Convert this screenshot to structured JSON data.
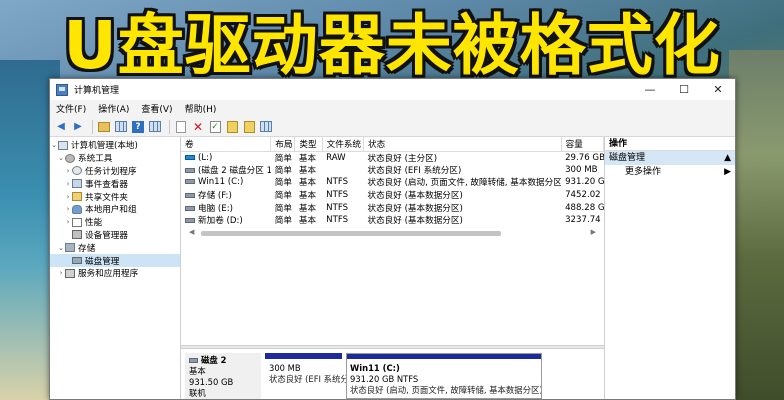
{
  "banner": {
    "text": "U盘驱动器未被格式化"
  },
  "window": {
    "title": "计算机管理",
    "controls": {
      "minimize": "—",
      "maximize": "☐",
      "close": "✕"
    }
  },
  "menu": [
    "文件(F)",
    "操作(A)",
    "查看(V)",
    "帮助(H)"
  ],
  "tree": {
    "root": "计算机管理(本地)",
    "system_tools": "系统工具",
    "task_scheduler": "任务计划程序",
    "event_viewer": "事件查看器",
    "shared_folders": "共享文件夹",
    "local_users": "本地用户和组",
    "performance": "性能",
    "device_manager": "设备管理器",
    "storage": "存储",
    "disk_management": "磁盘管理",
    "services_apps": "服务和应用程序"
  },
  "table": {
    "headers": [
      "卷",
      "布局",
      "类型",
      "文件系统",
      "状态",
      "容量"
    ],
    "rows": [
      [
        "(L:)",
        "简单",
        "基本",
        "RAW",
        "状态良好 (主分区)",
        "29.76 GB"
      ],
      [
        "(磁盘 2 磁盘分区 1)",
        "简单",
        "基本",
        "",
        "状态良好 (EFI 系统分区)",
        "300 MB"
      ],
      [
        "Win11 (C:)",
        "简单",
        "基本",
        "NTFS",
        "状态良好 (启动, 页面文件, 故障转储, 基本数据分区)",
        "931.20 GB"
      ],
      [
        "存储 (F:)",
        "简单",
        "基本",
        "NTFS",
        "状态良好 (基本数据分区)",
        "7452.02"
      ],
      [
        "电脑 (E:)",
        "简单",
        "基本",
        "NTFS",
        "状态良好 (基本数据分区)",
        "488.28 GB"
      ],
      [
        "新加卷 (D:)",
        "简单",
        "基本",
        "NTFS",
        "状态良好 (基本数据分区)",
        "3237.74"
      ]
    ]
  },
  "disk": {
    "name": "磁盘 2",
    "type": "基本",
    "size": "931.50 GB",
    "status": "联机",
    "partitions": [
      {
        "name": "",
        "size": "300 MB",
        "status": "状态良好 (EFI 系统分区)"
      },
      {
        "name": "Win11  (C:)",
        "size": "931.20 GB NTFS",
        "status": "状态良好 (启动, 页面文件, 故障转储, 基本数据分区)"
      }
    ]
  },
  "actions": {
    "header": "操作",
    "section": "磁盘管理",
    "more": "更多操作"
  },
  "colors": {
    "banner_text": "#ffe600",
    "selection": "#cde4f7",
    "partition_bar": "#1d2b9b"
  }
}
